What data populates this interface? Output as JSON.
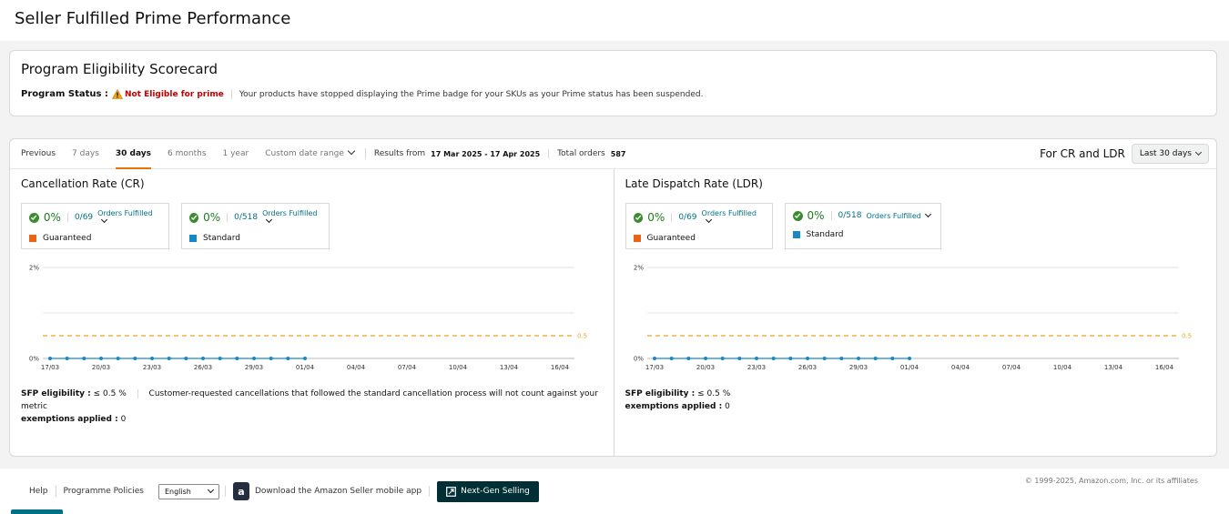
{
  "page": {
    "title": "Seller Fulfilled Prime Performance"
  },
  "scorecard": {
    "title": "Program Eligibility Scorecard",
    "status_label": "Program Status :",
    "status_value": "Not Eligible for prime",
    "status_message": "Your products have stopped displaying the Prime badge for your SKUs as your Prime status has been suspended."
  },
  "toolbar": {
    "tabs": [
      {
        "label": "Previous"
      },
      {
        "label": "7 days"
      },
      {
        "label": "30 days",
        "active": true
      },
      {
        "label": "6 months"
      },
      {
        "label": "1 year"
      }
    ],
    "custom_range": "Custom date range",
    "results_label": "Results from",
    "results_value": "17 Mar 2025 - 17 Apr 2025",
    "total_label": "Total orders",
    "total_value": "587",
    "for_label": "For CR and LDR",
    "period_select": "Last 30 days"
  },
  "panels": [
    {
      "title": "Cancellation Rate (CR)",
      "metrics": [
        {
          "pct": "0%",
          "fraction": "0/69",
          "link": "Orders Fulfilled",
          "legend": "Guaranteed",
          "color": "#e8641b"
        },
        {
          "pct": "0%",
          "fraction": "0/518",
          "link": "Orders Fulfilled",
          "legend": "Standard",
          "color": "#1a87c5"
        }
      ],
      "eligibility_label": "SFP eligibility :",
      "eligibility_value": "≤ 0.5 %",
      "note": "Customer-requested cancellations that followed the standard cancellation process will not count against your metric",
      "exemptions_label": "exemptions applied :",
      "exemptions_value": "0"
    },
    {
      "title": "Late Dispatch Rate (LDR)",
      "metrics": [
        {
          "pct": "0%",
          "fraction": "0/69",
          "link": "Orders Fulfilled",
          "legend": "Guaranteed",
          "color": "#e8641b"
        },
        {
          "pct": "0%",
          "fraction": "0/518",
          "link": "Orders Fulfilled",
          "legend": "Standard",
          "color": "#1a87c5"
        }
      ],
      "eligibility_label": "SFP eligibility :",
      "eligibility_value": "≤ 0.5 %",
      "note": "",
      "exemptions_label": "exemptions applied :",
      "exemptions_value": "0"
    }
  ],
  "chart_data": [
    {
      "type": "line",
      "title": "Cancellation Rate (CR)",
      "xlabel": "",
      "ylabel": "",
      "ylim": [
        0,
        2
      ],
      "yticks": [
        "0%",
        "2%"
      ],
      "threshold": {
        "value": 0.5,
        "label": "0.5",
        "color": "#f0a020"
      },
      "x_ticks": [
        "17/03",
        "20/03",
        "23/03",
        "26/03",
        "29/03",
        "01/04",
        "04/04",
        "07/04",
        "10/04",
        "13/04",
        "16/04"
      ],
      "series": [
        {
          "x": [
            "17/03",
            "18/03",
            "19/03",
            "20/03",
            "21/03",
            "22/03",
            "23/03",
            "24/03",
            "25/03",
            "26/03",
            "27/03",
            "28/03",
            "29/03",
            "30/03",
            "31/03",
            "01/04"
          ],
          "values": [
            0,
            0,
            0,
            0,
            0,
            0,
            0,
            0,
            0,
            0,
            0,
            0,
            0,
            0,
            0,
            0
          ],
          "color": "#1a87c5"
        }
      ],
      "grid": true
    },
    {
      "type": "line",
      "title": "Late Dispatch Rate (LDR)",
      "xlabel": "",
      "ylabel": "",
      "ylim": [
        0,
        2
      ],
      "yticks": [
        "0%",
        "2%"
      ],
      "threshold": {
        "value": 0.5,
        "label": "0.5",
        "color": "#f0a020"
      },
      "x_ticks": [
        "17/03",
        "20/03",
        "23/03",
        "26/03",
        "29/03",
        "01/04",
        "04/04",
        "07/04",
        "10/04",
        "13/04",
        "16/04"
      ],
      "series": [
        {
          "x": [
            "17/03",
            "18/03",
            "19/03",
            "20/03",
            "21/03",
            "22/03",
            "23/03",
            "24/03",
            "25/03",
            "26/03",
            "27/03",
            "28/03",
            "29/03",
            "30/03",
            "31/03",
            "01/04"
          ],
          "values": [
            0,
            0,
            0,
            0,
            0,
            0,
            0,
            0,
            0,
            0,
            0,
            0,
            0,
            0,
            0,
            0
          ],
          "color": "#1a87c5"
        }
      ],
      "grid": true
    }
  ],
  "footer": {
    "help": "Help",
    "policies": "Programme Policies",
    "language": "English",
    "app_text": "Download the Amazon Seller mobile app",
    "app_icon_letter": "a",
    "nextgen": "Next-Gen Selling",
    "copyright": "© 1999-2025, Amazon.com, Inc. or its affiliates"
  }
}
